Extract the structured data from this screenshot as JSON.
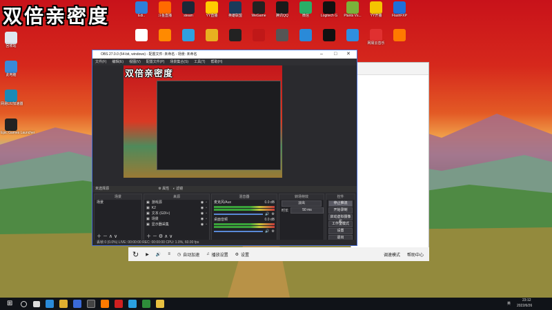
{
  "caption": "双倍亲密度",
  "desktop_icons_top": [
    {
      "label": "Edi..",
      "color": "#2f7fd8"
    },
    {
      "label": "斗鱼直播",
      "color": "#ff6a00"
    },
    {
      "label": "steam",
      "color": "#1b2838"
    },
    {
      "label": "YY直播",
      "color": "#ffcc00"
    },
    {
      "label": "英雄联盟",
      "color": "#1a3a5a"
    },
    {
      "label": "WeGame",
      "color": "#222222"
    },
    {
      "label": "腾讯QQ",
      "color": "#1a1a1a"
    },
    {
      "label": "微信",
      "color": "#2aae67"
    },
    {
      "label": "Logitech G",
      "color": "#111111"
    },
    {
      "label": "Plants Vs...",
      "color": "#7ab33a"
    },
    {
      "label": "YY开播",
      "color": "#f5c400"
    },
    {
      "label": "FlashFXP",
      "color": "#1e6fd9"
    }
  ],
  "desktop_icons_row2": [
    {
      "label": "",
      "color": "#ffffff"
    },
    {
      "label": "",
      "color": "#ff8a00"
    },
    {
      "label": "",
      "color": "#2fa0e0"
    },
    {
      "label": "",
      "color": "#e8b020"
    },
    {
      "label": "",
      "color": "#222222"
    },
    {
      "label": "",
      "color": "#c01818"
    },
    {
      "label": "",
      "color": "#555555"
    },
    {
      "label": "",
      "color": "#2a8ad8"
    },
    {
      "label": "",
      "color": "#111111"
    },
    {
      "label": "",
      "color": "#2e8fe0"
    },
    {
      "label": "网易云音乐",
      "color": "#e03030"
    },
    {
      "label": "",
      "color": "#ff7a00"
    }
  ],
  "desktop_icons_left": [
    {
      "label": "回收站",
      "color": "#dfe8f0"
    },
    {
      "label": "此电脑",
      "color": "#3a8ad8"
    },
    {
      "label": "网易UU加速器",
      "color": "#1a8ab8"
    },
    {
      "label": "Epic Games Launcher",
      "color": "#222222"
    }
  ],
  "obs": {
    "title": "OBS 27.0.0 (64-bit, windows) - 配置文件: 未命名 - 场景: 未命名",
    "menu": [
      "文件(F)",
      "编辑(E)",
      "视图(V)",
      "配置文件(P)",
      "场景集合(S)",
      "工具(T)",
      "帮助(H)"
    ],
    "no_source": "未选择源",
    "props_btn": "属性",
    "filter_btn": "滤镜",
    "docks": {
      "scenes": {
        "title": "场景",
        "items": [
          "场景"
        ]
      },
      "sources": {
        "title": "来源",
        "items": [
          "游戏源",
          "K2",
          "文本 (GDI+)",
          "场景",
          "显示器采集"
        ]
      },
      "mixer": {
        "title": "混音器",
        "channels": [
          {
            "name": "麦克风/Aux",
            "db": "0.0 dB"
          },
          {
            "name": "桌面音频",
            "db": "0.0 dB"
          }
        ]
      },
      "transitions": {
        "title": "转场特效",
        "type": "淡出",
        "duration_label": "时长",
        "duration": "50 ms"
      },
      "controls": {
        "title": "控件",
        "buttons": [
          "停止推流",
          "开始录制",
          "启动虚拟摄像机",
          "工作室模式",
          "设置",
          "退出"
        ]
      }
    },
    "status": "丢帧 0 (0.0%)   LIVE: 00:00:00   REC: 00:00:00   CPU: 1.0%, 60.00 fps"
  },
  "media_bar": {
    "items": [
      "自动加速",
      "播放设置",
      "设置"
    ],
    "right": [
      "调速模式",
      "帮助中心"
    ]
  },
  "taskbar": {
    "time": "23:12",
    "date": "2022/6/26",
    "lang": "英"
  }
}
